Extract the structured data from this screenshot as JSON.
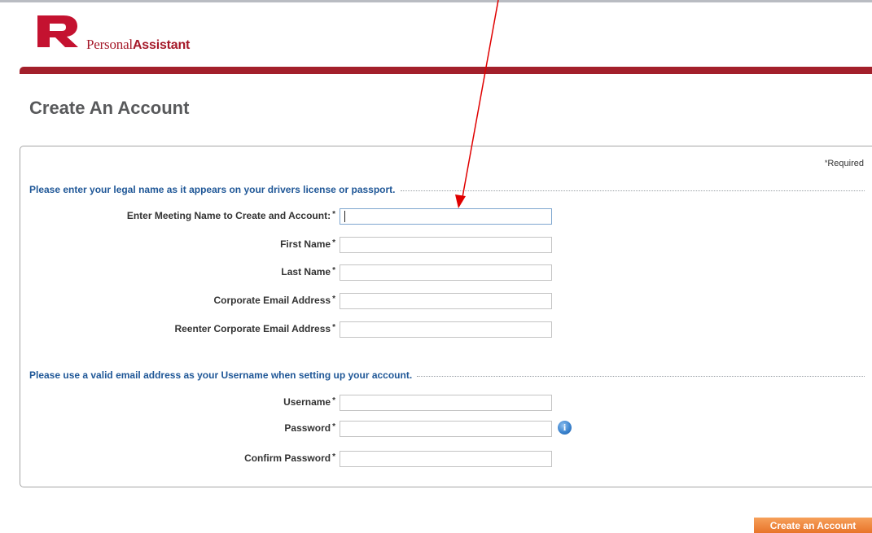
{
  "brand": {
    "name_regular": "Personal",
    "name_bold": "Assistant",
    "color": "#a51929"
  },
  "page_title": "Create An Account",
  "required_note": {
    "asterisk": "*",
    "text": "Required"
  },
  "section1": {
    "heading": "Please enter your legal name as it appears on your drivers license or passport.",
    "fields": [
      {
        "label": "Enter Meeting Name to Create and Account:",
        "value": ""
      },
      {
        "label": "First Name",
        "value": ""
      },
      {
        "label": "Last Name",
        "value": ""
      },
      {
        "label": "Corporate Email Address",
        "value": ""
      },
      {
        "label": "Reenter Corporate Email Address",
        "value": ""
      }
    ]
  },
  "section2": {
    "heading": "Please use a valid email address as your Username when setting up your account.",
    "fields": [
      {
        "label": "Username",
        "value": ""
      },
      {
        "label": "Password",
        "value": ""
      },
      {
        "label": "Confirm Password",
        "value": ""
      }
    ]
  },
  "required_marker": "*",
  "info_icon_glyph": "i",
  "submit_button": {
    "label": "Create an Account"
  },
  "colors": {
    "accent_red": "#a3202b",
    "heading_blue": "#1f5797",
    "button_orange": "#e8742a"
  }
}
